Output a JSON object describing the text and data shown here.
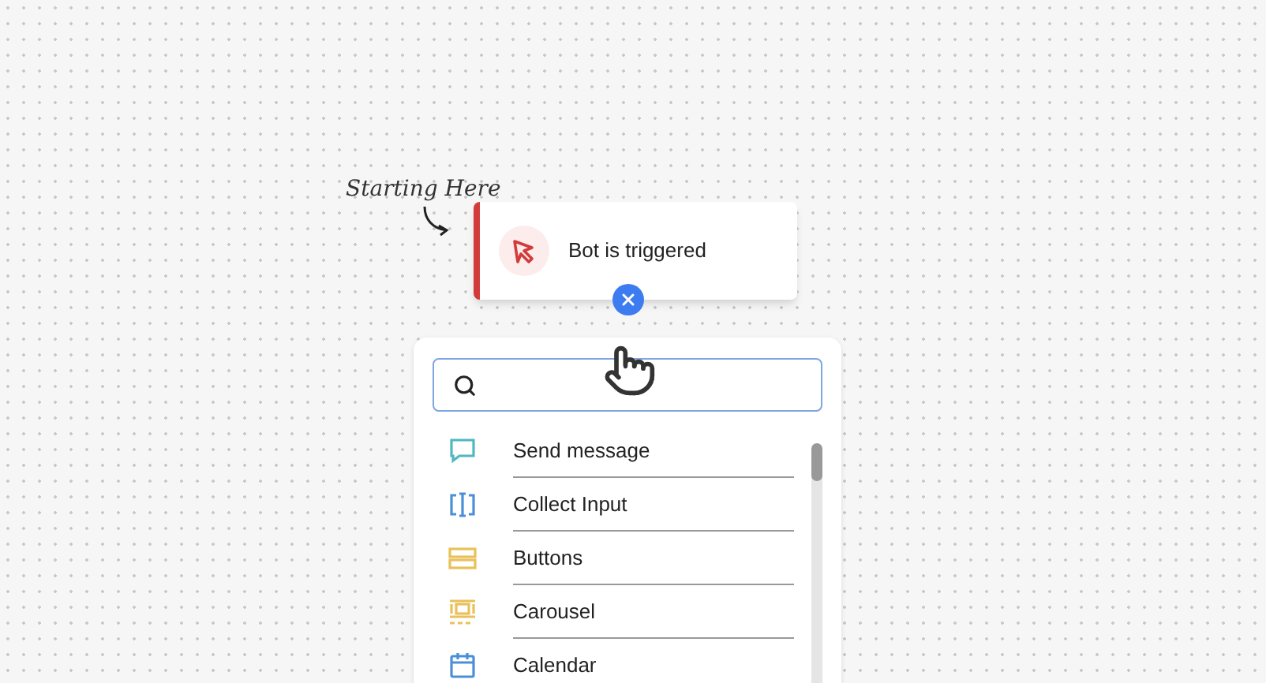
{
  "annotation": "Starting Here",
  "trigger": {
    "label": "Bot is triggered"
  },
  "picker": {
    "items": [
      {
        "label": "Send message",
        "kind": "message",
        "color": "#4fb8c0"
      },
      {
        "label": "Collect Input",
        "kind": "input",
        "color": "#4a8fd8"
      },
      {
        "label": "Buttons",
        "kind": "buttons",
        "color": "#e9c15a"
      },
      {
        "label": "Carousel",
        "kind": "carousel",
        "color": "#e9c15a"
      },
      {
        "label": "Calendar",
        "kind": "calendar",
        "color": "#4a8fd8"
      }
    ]
  }
}
